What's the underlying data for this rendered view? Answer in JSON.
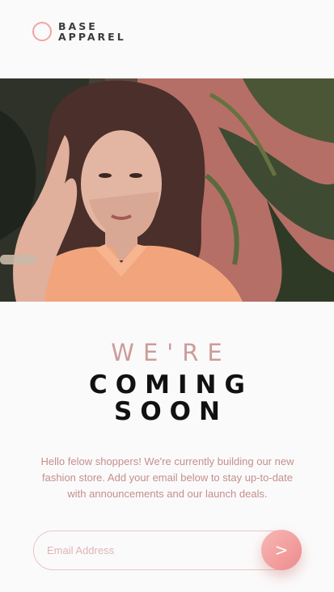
{
  "brand": {
    "line1": "BASE",
    "line2": "APPAREL",
    "ring_color": "#f1a3a4"
  },
  "hero": {
    "image": "woman-in-peach-shirt-photo"
  },
  "headline": {
    "line1": "WE'RE",
    "line2": "COMING",
    "line3": "SOON"
  },
  "description": "Hello felow shoppers! We're currently building our new fashion store. Add your email below to stay up-to-date with announcements and our launch deals.",
  "form": {
    "email_placeholder": "Email Address",
    "submit_icon": "arrow-right-icon",
    "submit_symbol": ">"
  },
  "colors": {
    "accent": "#ee8a8b",
    "text_soft": "#c58e8e",
    "dark": "#111111"
  }
}
